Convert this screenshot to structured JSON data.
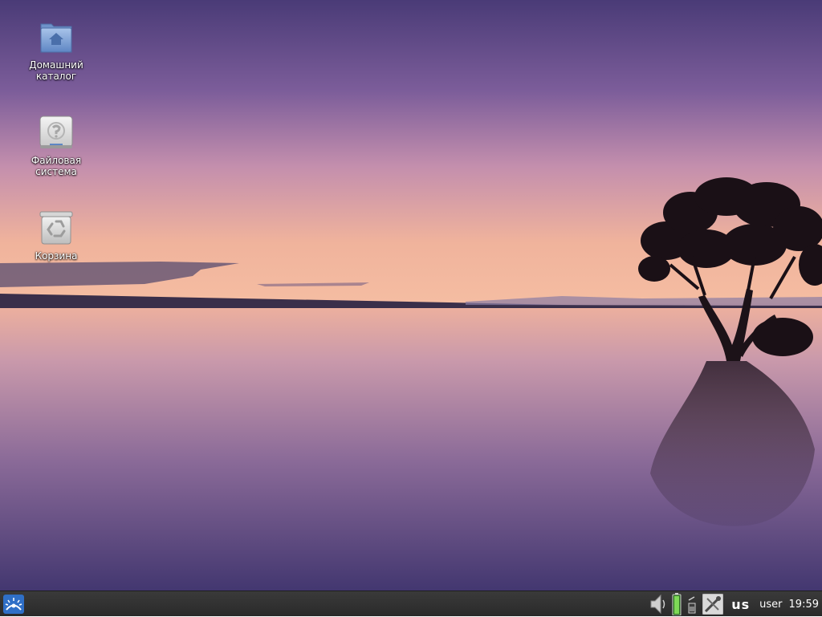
{
  "desktop": {
    "icons": [
      {
        "label": "Домашний\nкаталог",
        "icon": "home-folder-icon"
      },
      {
        "label": "Файловая\nсистема",
        "icon": "drive-harddisk-icon"
      },
      {
        "label": "Корзина",
        "icon": "trash-icon"
      }
    ]
  },
  "taskbar": {
    "menu_icon": "app-menu-icon",
    "tray": {
      "volume_icon": "volume-icon",
      "battery_icon": "battery-icon",
      "network_icon": "network-icon",
      "tools_icon": "tools-icon",
      "keyboard_layout": "us",
      "user": "user",
      "clock": "19:59"
    }
  },
  "colors": {
    "sky_top": "#4f3f7c",
    "horizon": "#f3b79a",
    "water_bottom": "#44396e",
    "taskbar": "#2e2e2e"
  }
}
